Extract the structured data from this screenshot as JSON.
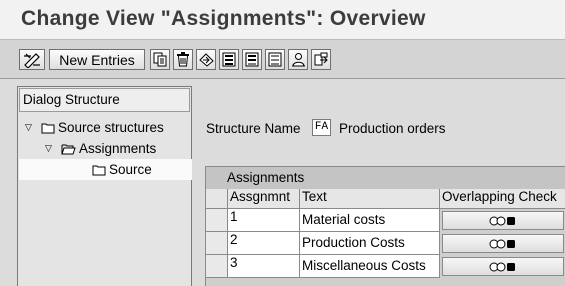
{
  "window": {
    "title": "Change View \"Assignments\": Overview"
  },
  "toolbar": {
    "new_entries_label": "New Entries",
    "icons": [
      "display-change-icon",
      "copy-icon",
      "delete-icon",
      "undo-icon",
      "select-all-icon",
      "select-block-icon",
      "deselect-all-icon",
      "where-used-icon",
      "navigate-icon"
    ]
  },
  "dialog_structure": {
    "header": "Dialog Structure",
    "items": [
      {
        "label": "Source structures",
        "expanded": true,
        "icon": "folder-icon"
      },
      {
        "label": "Assignments",
        "expanded": true,
        "icon": "open-folder-icon"
      },
      {
        "label": "Source",
        "selected": true,
        "icon": "folder-icon"
      }
    ]
  },
  "structure": {
    "name_label": "Structure Name",
    "code": "FA",
    "description": "Production orders"
  },
  "assignments": {
    "title": "Assignments",
    "columns": [
      "Assgnmnt",
      "Text",
      "Overlapping Check"
    ],
    "rows": [
      {
        "id": "1",
        "text": "Material costs"
      },
      {
        "id": "2",
        "text": "Production Costs"
      },
      {
        "id": "3",
        "text": "Miscellaneous Costs"
      }
    ]
  }
}
